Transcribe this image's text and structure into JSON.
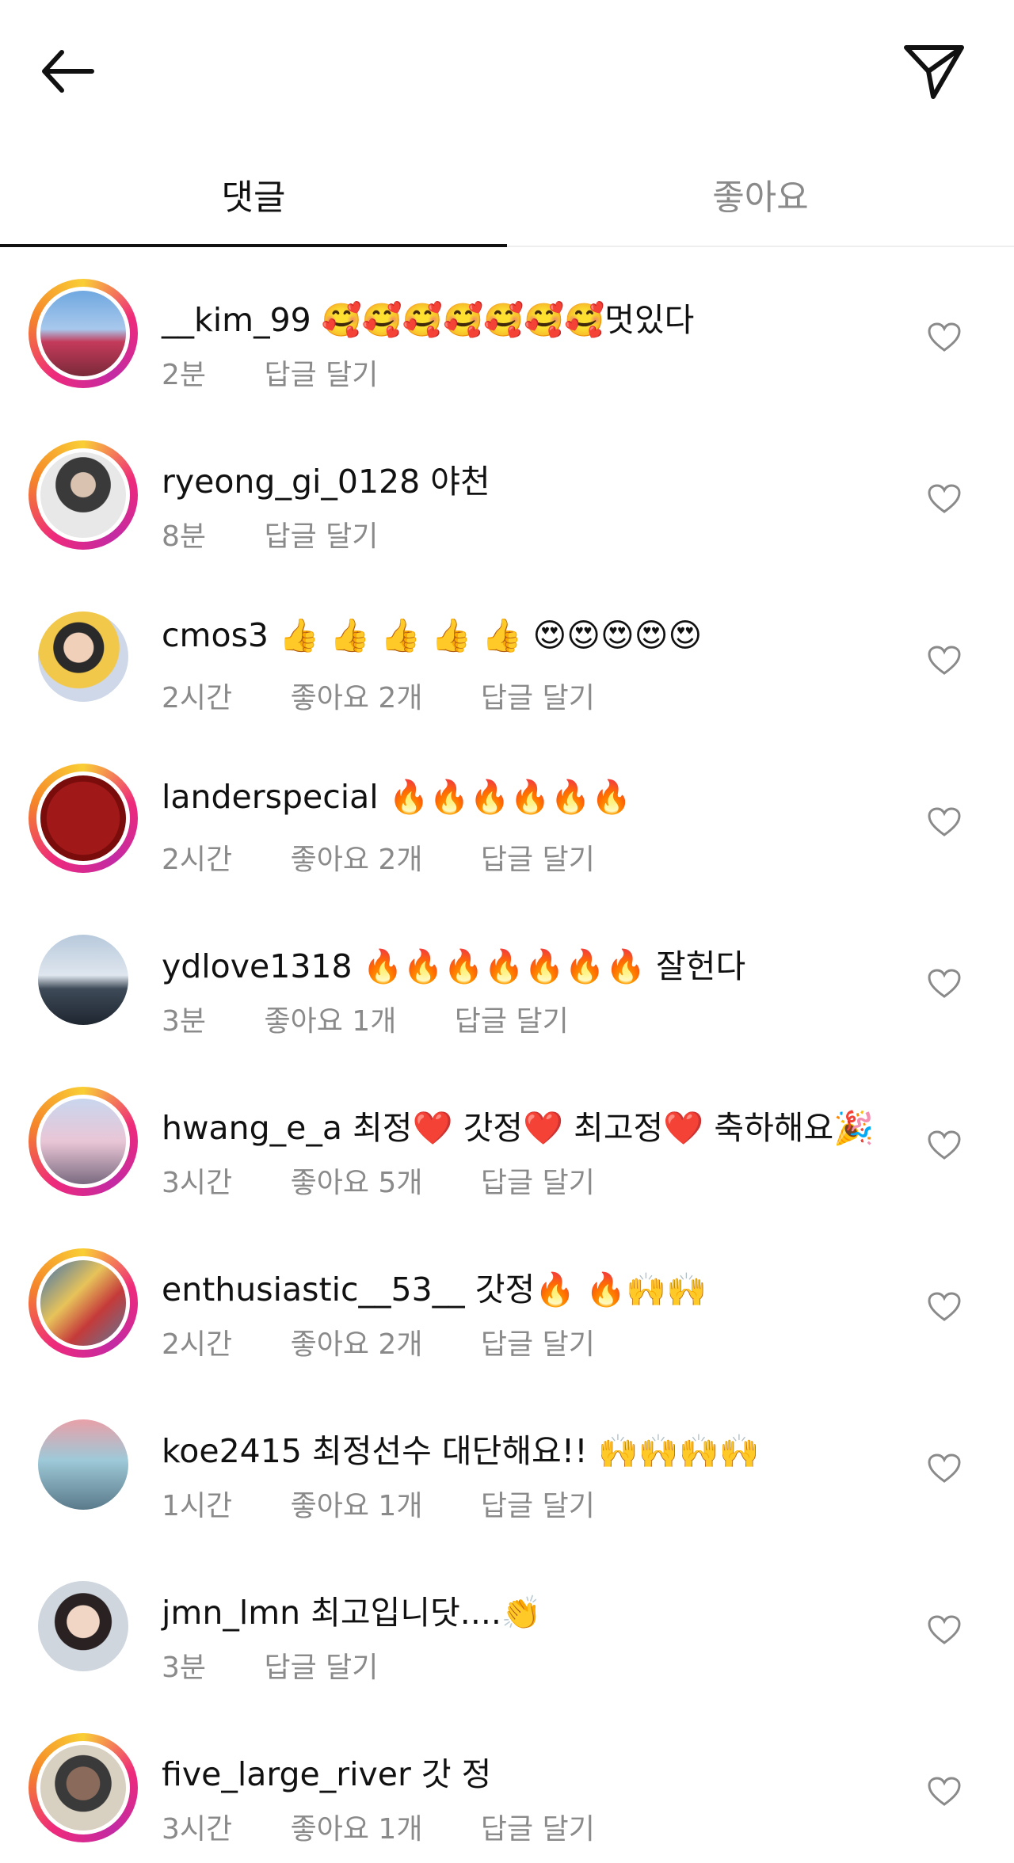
{
  "tabs": [
    {
      "label": "댓글",
      "active": true
    },
    {
      "label": "좋아요",
      "active": false
    }
  ],
  "reply_label": "답글 달기",
  "icons": {
    "back": "arrow-left-icon",
    "send": "paper-plane-icon",
    "like": "heart-outline-icon"
  },
  "colors": {
    "ring_start": "#f9ce34",
    "ring_mid": "#ee2a7b",
    "ring_end": "#c32aa3",
    "meta_gray": "#8a8a8a",
    "divider": "#eeeeee"
  },
  "comments": [
    {
      "username": "__kim_99",
      "text": "🥰🥰🥰🥰🥰🥰🥰멋있다",
      "time": "2분",
      "likes": "",
      "story_ring": true
    },
    {
      "username": "ryeong_gi_0128",
      "text": "야천",
      "time": "8분",
      "likes": "",
      "story_ring": true
    },
    {
      "username": "cmos3",
      "text": "👍 👍 👍 👍 👍 😍😍😍😍😍",
      "time": "2시간",
      "likes": "좋아요 2개",
      "story_ring": false
    },
    {
      "username": "landerspecial",
      "text": "🔥🔥🔥🔥🔥🔥",
      "time": "2시간",
      "likes": "좋아요 2개",
      "story_ring": true
    },
    {
      "username": "ydlove1318",
      "text": "🔥🔥🔥🔥🔥🔥🔥 잘헌다",
      "time": "3분",
      "likes": "좋아요 1개",
      "story_ring": false
    },
    {
      "username": "hwang_e_a",
      "text": "최정❤️ 갓정❤️ 최고정❤️ 축하해요🎉",
      "time": "3시간",
      "likes": "좋아요 5개",
      "story_ring": true
    },
    {
      "username": "enthusiastic__53__",
      "text": "갓정🔥 🔥🙌🙌",
      "time": "2시간",
      "likes": "좋아요 2개",
      "story_ring": true
    },
    {
      "username": "koe2415",
      "text": "최정선수 대단해요!! 🙌🙌🙌🙌",
      "time": "1시간",
      "likes": "좋아요 1개",
      "story_ring": false
    },
    {
      "username": "jmn_lmn",
      "text": "최고입니닷....👏",
      "time": "3분",
      "likes": "",
      "story_ring": false
    },
    {
      "username": "five_large_river",
      "text": "갓 정",
      "time": "3시간",
      "likes": "좋아요 1개",
      "story_ring": true
    }
  ]
}
